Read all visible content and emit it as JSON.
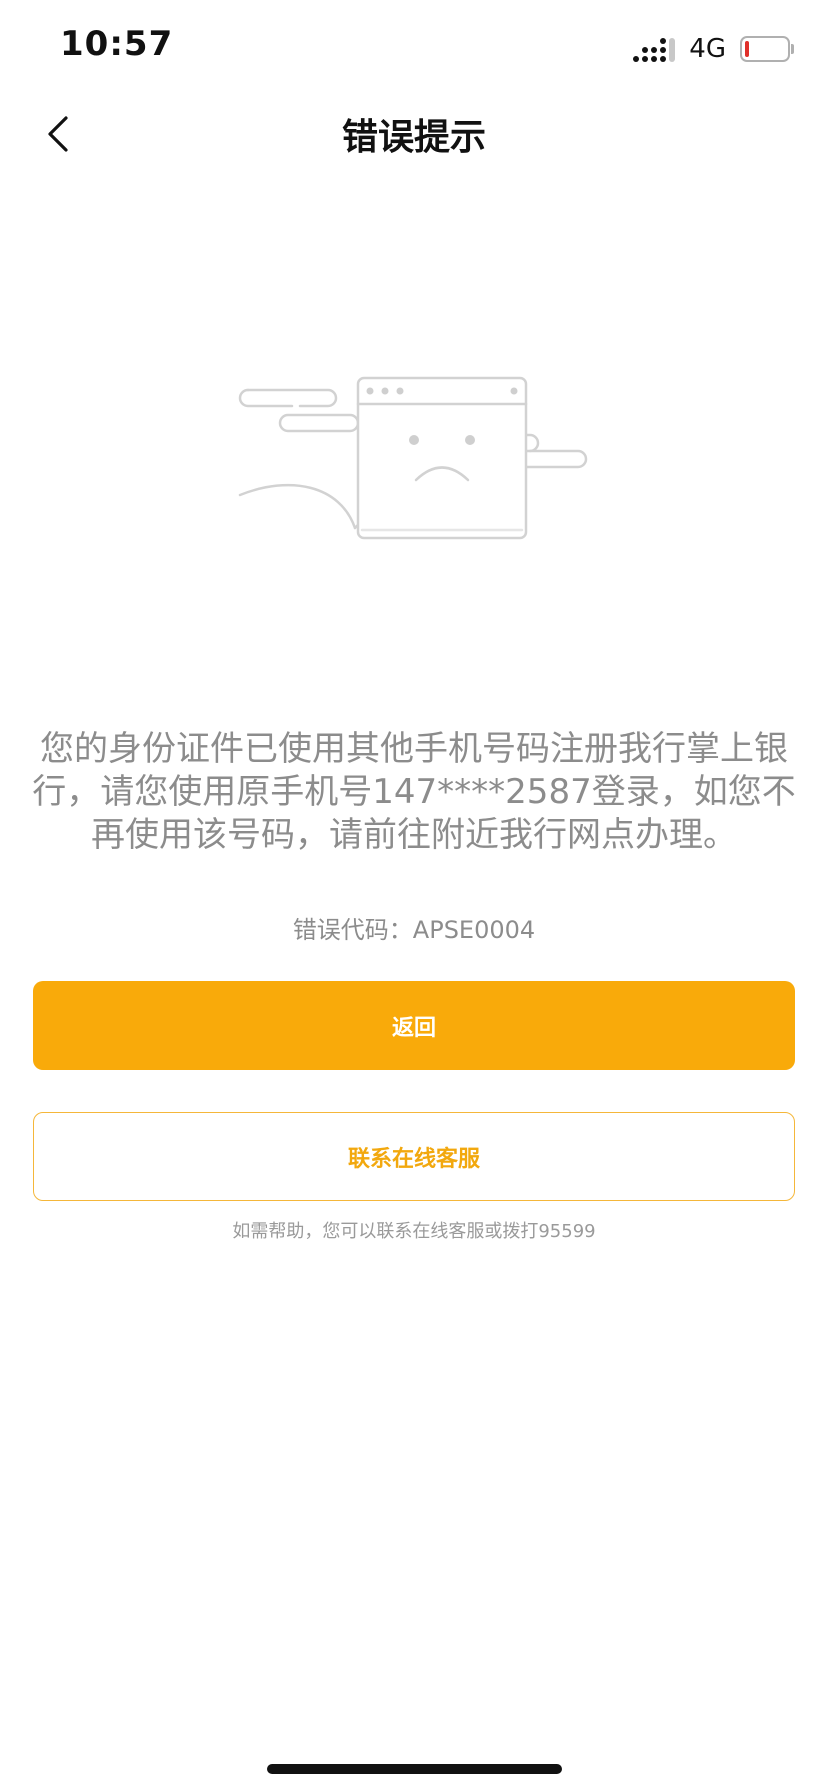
{
  "status_bar": {
    "time": "10:57",
    "network": "4G",
    "battery_level_pct": 10,
    "battery_color": "#e0302a"
  },
  "nav": {
    "title": "错误提示",
    "back_icon": "chevron-left-icon"
  },
  "illustration": {
    "icon": "sad-browser-window-illustration"
  },
  "error": {
    "message": "您的身份证件已使用其他手机号码注册我行掌上银行，请您使用原手机号147****2587登录，如您不再使用该号码，请前往附近我行网点办理。",
    "code_text": "错误代码：APSE0004"
  },
  "buttons": {
    "back_label": "返回",
    "contact_label": "联系在线客服"
  },
  "help": {
    "text": "如需帮助，您可以联系在线客服或拨打95599"
  },
  "colors": {
    "accent": "#f9aa0a",
    "text_gray": "#8c8c8c"
  }
}
